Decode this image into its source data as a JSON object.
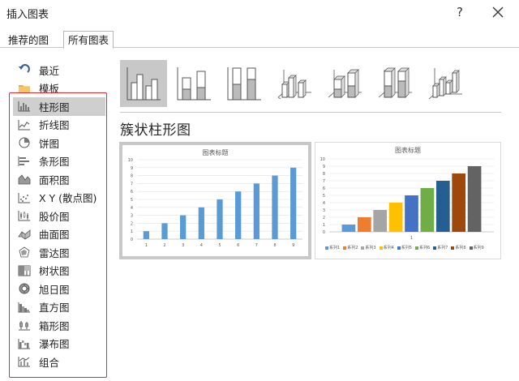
{
  "window": {
    "title": "插入图表",
    "help_label": "?"
  },
  "tabs": [
    {
      "label": "推荐的图表"
    },
    {
      "label": "所有图表"
    }
  ],
  "sidebar": {
    "items": [
      {
        "label": "最近",
        "icon": "recent-icon"
      },
      {
        "label": "模板",
        "icon": "folder-icon"
      },
      {
        "label": "柱形图",
        "icon": "column-chart-icon",
        "selected": true
      },
      {
        "label": "折线图",
        "icon": "line-chart-icon"
      },
      {
        "label": "饼图",
        "icon": "pie-chart-icon"
      },
      {
        "label": "条形图",
        "icon": "bar-chart-icon"
      },
      {
        "label": "面积图",
        "icon": "area-chart-icon"
      },
      {
        "label": "X Y (散点图)",
        "icon": "scatter-chart-icon"
      },
      {
        "label": "股价图",
        "icon": "stock-chart-icon"
      },
      {
        "label": "曲面图",
        "icon": "surface-chart-icon"
      },
      {
        "label": "雷达图",
        "icon": "radar-chart-icon"
      },
      {
        "label": "树状图",
        "icon": "treemap-chart-icon"
      },
      {
        "label": "旭日图",
        "icon": "sunburst-chart-icon"
      },
      {
        "label": "直方图",
        "icon": "histogram-chart-icon"
      },
      {
        "label": "箱形图",
        "icon": "box-whisker-chart-icon"
      },
      {
        "label": "瀑布图",
        "icon": "waterfall-chart-icon"
      },
      {
        "label": "组合",
        "icon": "combo-chart-icon"
      }
    ]
  },
  "subtypes": [
    {
      "icon": "clustered-column-icon",
      "selected": true
    },
    {
      "icon": "stacked-column-icon"
    },
    {
      "icon": "100-stacked-column-icon"
    },
    {
      "icon": "3d-clustered-column-icon"
    },
    {
      "icon": "3d-stacked-column-icon"
    },
    {
      "icon": "3d-100-stacked-column-icon"
    },
    {
      "icon": "3d-column-icon"
    }
  ],
  "subtype_title": "簇状柱形图",
  "colors": {
    "selection_bg": "#c8c8c8",
    "highlight_border": "#e52b2b",
    "preview1_bar": "#5b9bd5"
  },
  "chart_data": [
    {
      "type": "bar",
      "title": "图表标题",
      "categories": [
        "1",
        "2",
        "3",
        "4",
        "5",
        "6",
        "7",
        "8",
        "9"
      ],
      "values": [
        1,
        2,
        3,
        4,
        5,
        6,
        7,
        8,
        9
      ],
      "ylim": [
        0,
        10
      ],
      "yticks": [
        0,
        1,
        2,
        3,
        4,
        5,
        6,
        7,
        8,
        9,
        10
      ],
      "grid": true
    },
    {
      "type": "bar",
      "title": "图表标题",
      "categories": [
        "1"
      ],
      "series": [
        {
          "name": "系列1",
          "values": [
            1
          ],
          "color": "#5b9bd5"
        },
        {
          "name": "系列2",
          "values": [
            2
          ],
          "color": "#ed7d31"
        },
        {
          "name": "系列3",
          "values": [
            3
          ],
          "color": "#a5a5a5"
        },
        {
          "name": "系列4",
          "values": [
            4
          ],
          "color": "#ffc000"
        },
        {
          "name": "系列5",
          "values": [
            5
          ],
          "color": "#4472c4"
        },
        {
          "name": "系列6",
          "values": [
            6
          ],
          "color": "#70ad47"
        },
        {
          "name": "系列7",
          "values": [
            7
          ],
          "color": "#255e91"
        },
        {
          "name": "系列8",
          "values": [
            8
          ],
          "color": "#9e480e"
        },
        {
          "name": "系列9",
          "values": [
            9
          ],
          "color": "#636363"
        }
      ],
      "ylim": [
        0,
        10
      ],
      "yticks": [
        0,
        1,
        2,
        3,
        4,
        5,
        6,
        7,
        8,
        9,
        10
      ],
      "grid": true,
      "legend": "bottom"
    }
  ]
}
